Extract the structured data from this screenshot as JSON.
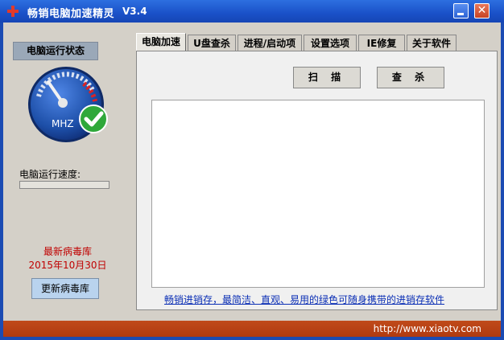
{
  "window": {
    "title": "畅销电脑加速精灵",
    "version": "V3.4"
  },
  "sidebar": {
    "status_label": "电脑运行状态",
    "gauge_unit": "MHZ",
    "speed_label": "电脑运行速度:",
    "speed_progress": 0,
    "virus_db_title": "最新病毒库",
    "virus_db_date": "2015年10月30日",
    "update_button": "更新病毒库"
  },
  "tabs": [
    {
      "label": "电脑加速",
      "active": true
    },
    {
      "label": "U盘查杀",
      "active": false
    },
    {
      "label": "进程/启动项",
      "active": false
    },
    {
      "label": "设置选项",
      "active": false
    },
    {
      "label": "IE修复",
      "active": false
    },
    {
      "label": "关于软件",
      "active": false
    }
  ],
  "main": {
    "scan_button": "扫 描",
    "kill_button": "查 杀",
    "bottom_link": "畅销进销存，最简洁、直观、易用的绿色可随身携带的进销存软件"
  },
  "footer": {
    "url": "http://www.xiaotv.com"
  },
  "colors": {
    "titlebar": "#1a51c8",
    "footer": "#b03a10",
    "accent_red": "#c00000"
  }
}
